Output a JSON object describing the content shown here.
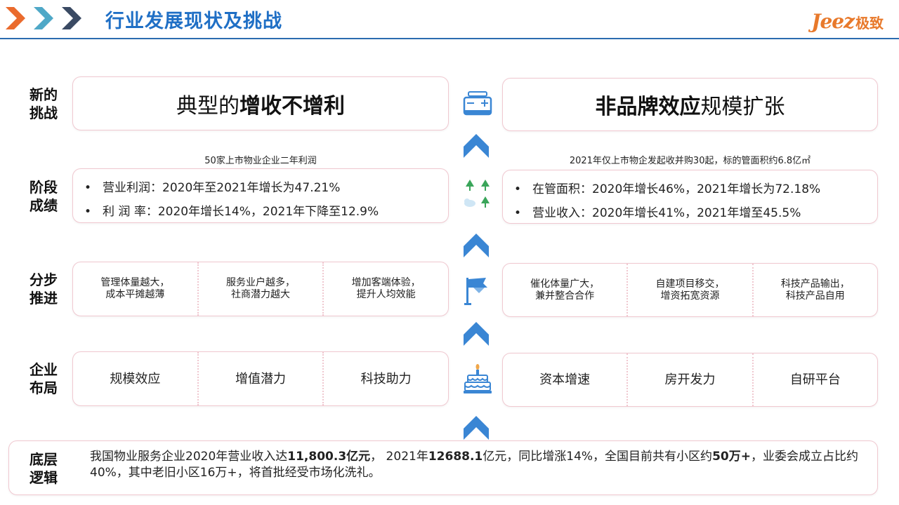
{
  "header": {
    "title": "行业发展现状及挑战",
    "logo_en": "Jeez",
    "logo_cn": "极致",
    "colors": {
      "title": "#1f6fc5",
      "chevron_orange": "#ea6b2d",
      "chevron_teal": "#4fa8c7",
      "chevron_navy": "#3a4a63",
      "logo": "#e8792b"
    }
  },
  "rows": {
    "challenge": {
      "label_line1": "新的",
      "label_line2": "挑战",
      "left": {
        "prefix": "典型的",
        "bold": "增收不增利"
      },
      "right": {
        "bold": "非品牌效应",
        "suffix": "规模扩张"
      },
      "icon": "battery-icon"
    },
    "results": {
      "label_line1": "阶段",
      "label_line2": "成绩",
      "left_caption": "50家上市物业企业二年利润",
      "right_caption": "2021年仅上市物企发起收并购30起，标的管面积约6.8亿㎡",
      "left_items": [
        "营业利润：2020年至2021年增长为47.21%",
        "利  润  率：2020年增长14%，2021年下降至12.9%"
      ],
      "right_items": [
        "在管面积：2020年增长46%，2021年增长为72.18%",
        "营业收入：2020年增长41%，2021年增至45.5%"
      ],
      "icon": "trees-icon"
    },
    "steps": {
      "label_line1": "分步",
      "label_line2": "推进",
      "left_cells": [
        {
          "line1": "管理体量越大，",
          "line2": "成本平摊越薄"
        },
        {
          "line1": "服务业户越多，",
          "line2": "社商潜力越大"
        },
        {
          "line1": "增加客端体验，",
          "line2": "提升人均效能"
        }
      ],
      "right_cells": [
        {
          "line1": "催化体量广大，",
          "line2": "兼并整合合作"
        },
        {
          "line1": "自建项目移交，",
          "line2": "增资拓宽资源"
        },
        {
          "line1": "科技产品输出，",
          "line2": "科技产品自用"
        }
      ],
      "icon": "flag-icon"
    },
    "layout": {
      "label_line1": "企业",
      "label_line2": "布局",
      "left_cells": [
        "规模效应",
        "增值潜力",
        "科技助力"
      ],
      "right_cells": [
        "资本增速",
        "房开发力",
        "自研平台"
      ],
      "icon": "cake-icon"
    },
    "foundation": {
      "label_line1": "底层",
      "label_line2": "逻辑",
      "t1": "我国物业服务企业2020年营业收入达",
      "b1": "11,800.3亿元",
      "t2": "，  2021年",
      "b2": "12688.1",
      "t3": "亿元，同比增涨14%，全国目前共有小区约",
      "b3": "50万+",
      "t4": "，业委会成立占比约40%，其中老旧小区16万+，将首批经受市场化洗礼。"
    }
  },
  "icon_color": "#3a86d4"
}
